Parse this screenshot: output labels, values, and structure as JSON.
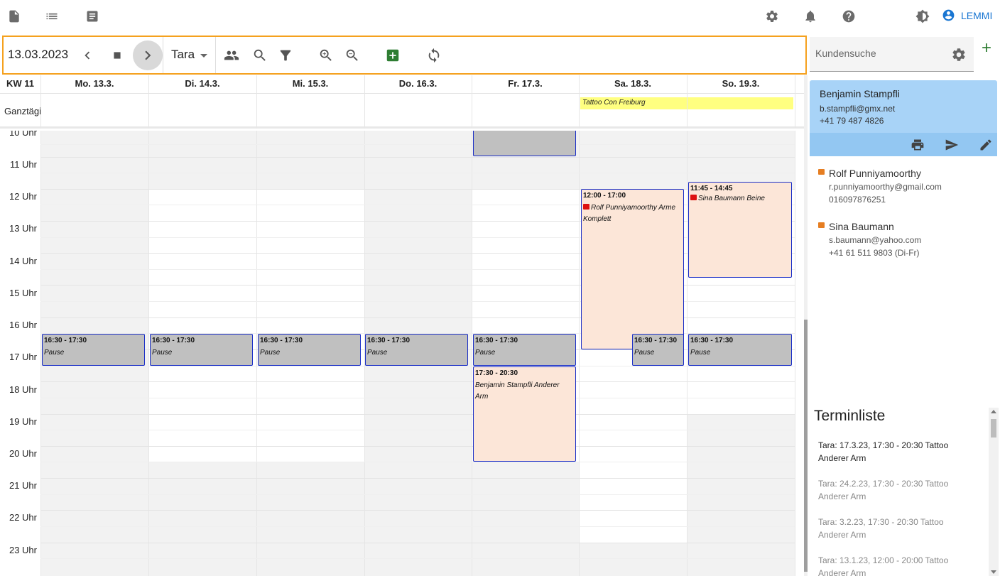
{
  "appbar": {
    "icons": [
      "document-icon",
      "list-icon",
      "notes-icon",
      "settings-icon",
      "bell-icon",
      "help-icon",
      "brightness-icon",
      "account-icon"
    ],
    "user_label": "LEMMI",
    "accent": "#1976d2"
  },
  "toolbar": {
    "date": "13.03.2023",
    "artist": "Tara",
    "border_color": "#f5a11e"
  },
  "calendar": {
    "week_label": "KW 11",
    "days": [
      "Mo. 13.3.",
      "Di. 14.3.",
      "Mi. 15.3.",
      "Do. 16.3.",
      "Fr. 17.3.",
      "Sa. 18.3.",
      "So. 19.3."
    ],
    "allday_label": "Ganztägig",
    "allday_event": "Tattoo Con Freiburg",
    "hours": [
      "10 Uhr",
      "11 Uhr",
      "12 Uhr",
      "13 Uhr",
      "14 Uhr",
      "15 Uhr",
      "16 Uhr",
      "17 Uhr",
      "18 Uhr",
      "19 Uhr",
      "20 Uhr",
      "21 Uhr",
      "22 Uhr",
      "23 Uhr"
    ],
    "events": [
      {
        "time": "16:30 - 17:30",
        "desc": "Pause"
      },
      {
        "time": "16:30 - 17:30",
        "desc": "Pause"
      },
      {
        "time": "16:30 - 17:30",
        "desc": "Pause"
      },
      {
        "time": "16:30 - 17:30",
        "desc": "Pause"
      },
      {
        "time": "16:30 - 17:30",
        "desc": "Pause"
      },
      {
        "time": "17:30 - 20:30",
        "desc": "Benjamin Stampfli Anderer Arm"
      },
      {
        "time": "12:00 - 17:00",
        "desc": "Rolf Punniyamoorthy Arme Komplett"
      },
      {
        "time": "16:30 - 17:30",
        "desc": "Pause"
      },
      {
        "time": "11:45 - 14:45",
        "desc": "Sina Baumann Beine"
      },
      {
        "time": "16:30 - 17:30",
        "desc": "Pause"
      }
    ]
  },
  "sidebar": {
    "search_placeholder": "Kundensuche",
    "add_label": "+",
    "selected_customer": {
      "name": "Benjamin Stampfli",
      "email": "b.stampfli@gmx.net",
      "phone": "+41 79 487 4826"
    },
    "customers": [
      {
        "name": "Rolf Punniyamoorthy",
        "email": "r.punniyamoorthy@gmail.com",
        "phone": "016097876251"
      },
      {
        "name": "Sina Baumann",
        "email": "s.baumann@yahoo.com",
        "phone": "+41 61 511 9803 (Di-Fr)"
      }
    ],
    "termin_title": "Terminliste",
    "termine": [
      {
        "line1": "Tara: 17.3.23, 17:30 - 20:30 Tattoo",
        "line2": "Anderer Arm"
      },
      {
        "line1": "Tara: 24.2.23, 17:30 - 20:30 Tattoo",
        "line2": "Anderer Arm"
      },
      {
        "line1": "Tara: 3.2.23, 17:30 - 20:30 Tattoo",
        "line2": "Anderer Arm"
      },
      {
        "line1": "Tara: 13.1.23, 12:00 - 20:00 Tattoo",
        "line2": "Anderer Arm"
      }
    ]
  }
}
